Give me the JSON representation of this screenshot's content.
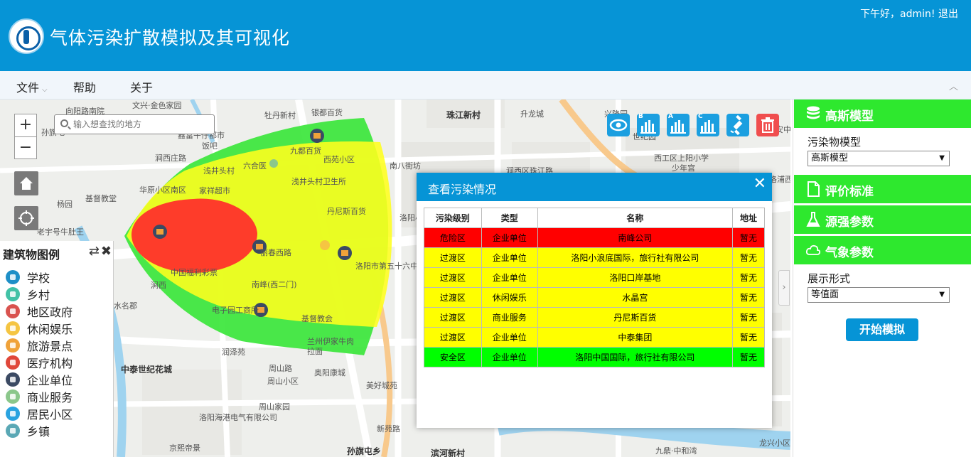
{
  "header": {
    "app_title": "气体污染扩散模拟及其可视化",
    "greeting": "下午好，admin! 退出"
  },
  "menu": {
    "items": [
      {
        "label": "文件",
        "has_dropdown": true
      },
      {
        "label": "帮助"
      },
      {
        "label": "关于"
      }
    ]
  },
  "map": {
    "search": {
      "placeholder": "输入想查找的地方"
    },
    "zoom_in": "+",
    "zoom_out": "−",
    "toolbar_icons": [
      "eye-icon",
      "bar-chart-b-icon",
      "bar-chart-a-icon",
      "bar-chart-c-icon",
      "satellite-icon",
      "trash-icon"
    ],
    "toolbar_sublabels": {
      "b": "B",
      "a": "A",
      "c": "C"
    },
    "zone_colors": {
      "danger": "#ff2b2b",
      "transition": "#ffff1e",
      "safe": "#3be63b"
    },
    "labels": [
      "文兴·金色家园",
      "向阳路南院",
      "牡丹新村",
      "银都百货",
      "珠江新村",
      "升龙城",
      "兴隆园",
      "世纪园",
      "东安中路",
      "西工区上阳小学",
      "少年宫",
      "孙旗屯",
      "鑫富午仔都市",
      "饭吧",
      "涧西庄路",
      "浅井头村",
      "六合医",
      "九都百货",
      "西苑小区",
      "南八街坊",
      "涧西区珠江路",
      "浅井头村卫生所",
      "丹尼斯百货",
      "洛阳小浪底",
      "基督教堂",
      "杨园",
      "华原小区南区",
      "家祥超市",
      "老宇号牛肚王",
      "中国福利彩票",
      "丽春西路",
      "南峰(西二门)",
      "电子园工商所",
      "基督教会",
      "兰州伊家牛肉",
      "拉面",
      "洛阳市第五十六中学",
      "中泰世纪花城",
      "润泽苑",
      "周山路",
      "奥阳康城",
      "周山小区",
      "美好城苑",
      "洛阳海港电气有限公司",
      "周山家园",
      "新苑路",
      "孙旗屯乡",
      "滨河新村",
      "九鼎·中和湾",
      "龙兴小区",
      "京熙帝景",
      "水名郡",
      "涧西",
      "洛浦西"
    ]
  },
  "legend": {
    "title": "建筑物图例",
    "items": [
      {
        "label": "学校",
        "icon": "school-icon",
        "color": "#1e8fc7"
      },
      {
        "label": "乡村",
        "icon": "village-icon",
        "color": "#42c2a6"
      },
      {
        "label": "地区政府",
        "icon": "government-icon",
        "color": "#d9534f"
      },
      {
        "label": "休闲娱乐",
        "icon": "leisure-icon",
        "color": "#f5c542"
      },
      {
        "label": "旅游景点",
        "icon": "scenic-icon",
        "color": "#f0a23a"
      },
      {
        "label": "医疗机构",
        "icon": "medical-icon",
        "color": "#e0473a"
      },
      {
        "label": "企业单位",
        "icon": "enterprise-icon",
        "color": "#3b4a63"
      },
      {
        "label": "商业服务",
        "icon": "commerce-icon",
        "color": "#8bc78b"
      },
      {
        "label": "居民小区",
        "icon": "residence-icon",
        "color": "#2aa3e0"
      },
      {
        "label": "乡镇",
        "icon": "town-icon",
        "color": "#5aa8b5"
      }
    ]
  },
  "dialog": {
    "title": "查看污染情况",
    "close": "✕",
    "columns": [
      "污染级别",
      "类型",
      "名称",
      "地址"
    ],
    "rows": [
      {
        "level": "危险区",
        "type": "企业单位",
        "name": "南峰公司",
        "address": "暂无",
        "color": "#ff0000"
      },
      {
        "level": "过渡区",
        "type": "企业单位",
        "name": "洛阳小浪底国际，旅行社有限公司",
        "address": "暂无",
        "color": "#ffff00"
      },
      {
        "level": "过渡区",
        "type": "企业单位",
        "name": "洛阳口岸基地",
        "address": "暂无",
        "color": "#ffff00"
      },
      {
        "level": "过渡区",
        "type": "休闲娱乐",
        "name": "水晶宫",
        "address": "暂无",
        "color": "#ffff00"
      },
      {
        "level": "过渡区",
        "type": "商业服务",
        "name": "丹尼斯百货",
        "address": "暂无",
        "color": "#ffff00"
      },
      {
        "level": "过渡区",
        "type": "企业单位",
        "name": "中泰集团",
        "address": "暂无",
        "color": "#ffff00"
      },
      {
        "level": "安全区",
        "type": "企业单位",
        "name": "洛阳中国国际，旅行社有限公司",
        "address": "暂无",
        "color": "#00ff00"
      }
    ]
  },
  "panel": {
    "sections": [
      {
        "label": "高斯模型",
        "icon": "database-icon"
      },
      {
        "label": "评价标准",
        "icon": "document-icon"
      },
      {
        "label": "源强参数",
        "icon": "flask-icon"
      },
      {
        "label": "气象参数",
        "icon": "cloud-icon"
      }
    ],
    "pollutant_model_label": "污染物模型",
    "pollutant_model_value": "高斯模型",
    "display_form_label": "展示形式",
    "display_form_value": "等值面",
    "start_button": "开始模拟"
  },
  "accent_color": "#0694d6"
}
